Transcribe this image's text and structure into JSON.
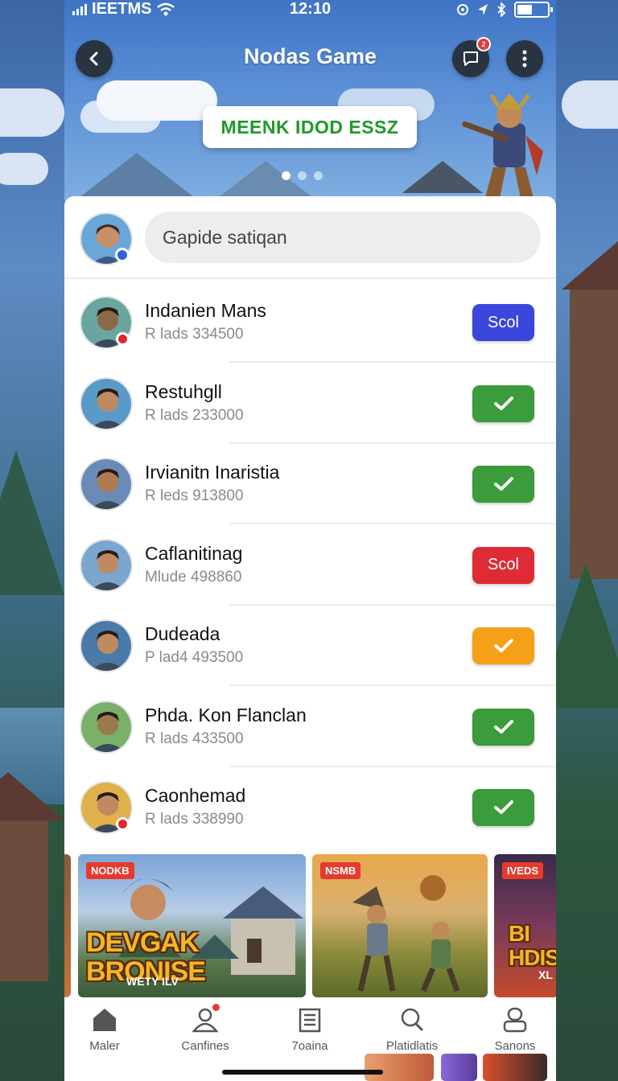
{
  "status_bar": {
    "carrier": "IEETMS",
    "time": "12:10"
  },
  "header": {
    "title": "Nodas Game",
    "chat_badge": "2",
    "promo_button": "MEENK IDOD ESSZ",
    "carousel_dots": 3
  },
  "search": {
    "placeholder": "Gapide satiqan"
  },
  "players": [
    {
      "name": "Indanien Mans",
      "subtitle": "R lads 334500",
      "action": "Scol",
      "action_type": "label",
      "color": "#3a46dc",
      "status_dot": true
    },
    {
      "name": "Restuhgll",
      "subtitle": "R lads 233000",
      "action": "",
      "action_type": "check",
      "color": "#3c9b3a",
      "status_dot": false
    },
    {
      "name": "Irvianitn Inaristia",
      "subtitle": "R leds 913800",
      "action": "",
      "action_type": "check",
      "color": "#3c9b3a",
      "status_dot": false
    },
    {
      "name": "Caflanitinag",
      "subtitle": "Mlude 498860",
      "action": "Scol",
      "action_type": "label",
      "color": "#df2b36",
      "status_dot": false
    },
    {
      "name": "Dudeada",
      "subtitle": "P lad4 493500",
      "action": "",
      "action_type": "check",
      "color": "#f4a019",
      "status_dot": false
    },
    {
      "name": "Phda. Kon Flanclan",
      "subtitle": "R lads 433500",
      "action": "",
      "action_type": "check",
      "color": "#3c9b3a",
      "status_dot": false
    },
    {
      "name": "Caonhemad",
      "subtitle": "R lads 338990",
      "action": "",
      "action_type": "check",
      "color": "#3c9b3a",
      "status_dot": true
    }
  ],
  "games": [
    {
      "tag": "NODKB",
      "logo_line1": "DEVGAK",
      "logo_line2": "BRONISE",
      "subtitle": "WETY ILV"
    },
    {
      "tag": "NSMB",
      "logo_line1": "",
      "logo_line2": "",
      "subtitle": ""
    },
    {
      "tag": "IVEDS",
      "logo_line1": "BI",
      "logo_line2": "HDISE",
      "subtitle": "XL"
    }
  ],
  "tabs": [
    {
      "label": "Maler",
      "icon": "home-icon"
    },
    {
      "label": "Canfines",
      "icon": "friends-icon"
    },
    {
      "label": "7oaina",
      "icon": "list-icon"
    },
    {
      "label": "Platidlatis",
      "icon": "search-icon"
    },
    {
      "label": "Sanons",
      "icon": "profile-icon"
    }
  ],
  "colors": {
    "accent_green": "#3c9b3a",
    "accent_blue": "#3a46dc",
    "accent_red": "#df2b36",
    "accent_orange": "#f4a019",
    "header_blue": "#3f74c4"
  }
}
